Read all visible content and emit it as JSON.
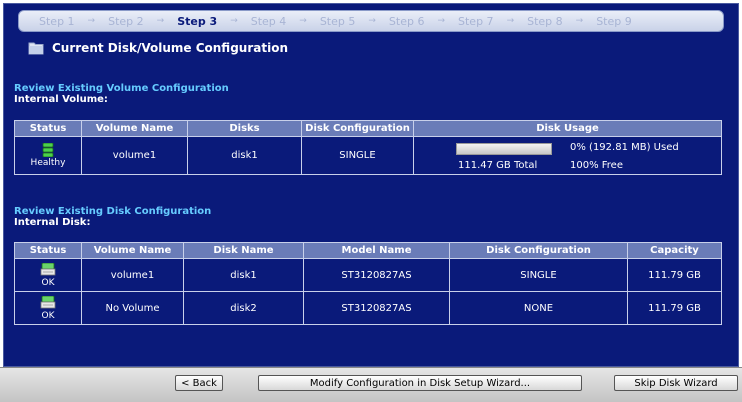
{
  "steps": [
    "Step 1",
    "Step 2",
    "Step 3",
    "Step 4",
    "Step 5",
    "Step 6",
    "Step 7",
    "Step 8",
    "Step 9"
  ],
  "active_step": "Step 3",
  "page_title": "Current Disk/Volume Configuration",
  "volume_section": {
    "heading": "Review Existing Volume Configuration",
    "subheading": "Internal Volume:",
    "columns": [
      "Status",
      "Volume Name",
      "Disks",
      "Disk Configuration",
      "Disk Usage"
    ],
    "rows": [
      {
        "status": "Healthy",
        "volume_name": "volume1",
        "disks": "disk1",
        "disk_configuration": "SINGLE",
        "usage_used": "0% (192.81 MB) Used",
        "usage_total": "111.47 GB Total",
        "usage_free": "100% Free",
        "usage_fraction": 0.0
      }
    ]
  },
  "disk_section": {
    "heading": "Review Existing Disk Configuration",
    "subheading": "Internal Disk:",
    "columns": [
      "Status",
      "Volume Name",
      "Disk Name",
      "Model Name",
      "Disk Configuration",
      "Capacity"
    ],
    "rows": [
      {
        "status": "OK",
        "volume_name": "volume1",
        "disk_name": "disk1",
        "model_name": "ST3120827AS",
        "disk_configuration": "SINGLE",
        "capacity": "111.79 GB"
      },
      {
        "status": "OK",
        "volume_name": "No Volume",
        "disk_name": "disk2",
        "model_name": "ST3120827AS",
        "disk_configuration": "NONE",
        "capacity": "111.79 GB"
      }
    ]
  },
  "buttons": {
    "back": "< Back",
    "modify": "Modify Configuration in Disk Setup Wizard...",
    "skip": "Skip Disk Wizard"
  },
  "icons": {
    "title": "folder-icon",
    "volume_status": "volume-healthy-icon",
    "disk_status": "disk-ok-icon"
  },
  "colors": {
    "background": "#0a1a7a",
    "header": "#6a7cb8",
    "heading": "#66ccff"
  }
}
